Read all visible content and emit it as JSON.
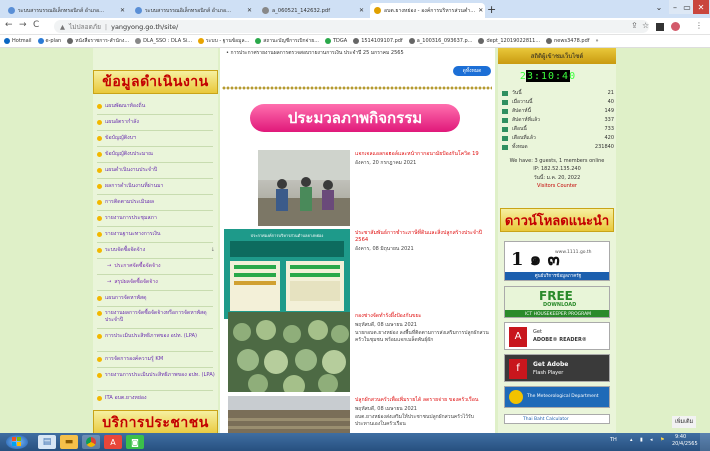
{
  "browser": {
    "tabs": [
      {
        "title": "ระบบสารบรรณอิเล็กทรอนิกส์ อำเภอ...",
        "active": false
      },
      {
        "title": "ระบบสารบรรณอิเล็กทรอนิกส์ อำเภอ...",
        "active": false
      },
      {
        "title": "a_060521_142632.pdf",
        "active": false
      },
      {
        "title": "อบต.ยางหย่อง - องค์การบริหารส่วนตำ...",
        "active": true
      }
    ],
    "new_tab": "+",
    "address": {
      "security": "ไม่ปลอดภัย",
      "url": "yangyong.go.th/site/"
    },
    "bookmarks": [
      "Hotmail",
      "e-plan",
      "หนังสือราชการ-สำนักง...",
      "DLA_SSO : DLA Si...",
      "ระบบ - ฐานข้อมูล...",
      "สถานะบัญชีการเบิกจ่าย...",
      "TDGA",
      "1514109107.pdf",
      "a_100316_093637.p...",
      "dept_12019022811...",
      "news3478.pdf"
    ],
    "bookmarks_more": "»"
  },
  "left": {
    "heading": "ข้อมูลดำเนินงาน",
    "items": [
      {
        "label": "แผนพัฒนาท้องถิ่น",
        "sub": false
      },
      {
        "label": "แผนอัตรากำลัง",
        "sub": false
      },
      {
        "label": "ข้อบัญญัติงบฯ",
        "sub": false
      },
      {
        "label": "ข้อบัญญัติงบประมาณ",
        "sub": false
      },
      {
        "label": "แผนดำเนินงานประจำปี",
        "sub": false
      },
      {
        "label": "ผลการดำเนินงานที่ผ่านมา",
        "sub": false
      },
      {
        "label": "การติดตามประเมินผล",
        "sub": false
      },
      {
        "label": "รายงานการประชุมสภา",
        "sub": false
      },
      {
        "label": "รายงานฐานะทางการเงิน",
        "sub": false
      },
      {
        "label": "ระบบจัดซื้อจัดจ้าง",
        "sub": false,
        "arrow": "↓"
      },
      {
        "label": "ประกาศจัดซื้อจัดจ้าง",
        "sub": true
      },
      {
        "label": "สรุปผลจัดซื้อจัดจ้าง",
        "sub": true
      },
      {
        "label": "แผนการจัดหาพัสดุ",
        "sub": false
      },
      {
        "label": "รายงานผลการจัดซื้อจัดจ้างหรือการจัดหาพัสดุประจำปี",
        "sub": false
      },
      {
        "label": "การประเมินประสิทธิภาพของ อปท. (LPA)",
        "sub": false
      },
      {
        "label": "การจัดการองค์ความรู้ KM",
        "sub": false
      },
      {
        "label": "รายงานการประเมินประสิทธิภาพของ อปท. (LPA)",
        "sub": false
      },
      {
        "label": "ITA อบต.ยางหย่อง",
        "sub": false
      }
    ],
    "heading2": "บริการประชาชน"
  },
  "center": {
    "marquee": "• การประกาศรายงานผลการตรวจสอบรายงานการเงิน ประจำปี 25 มกราคม 2565",
    "more_button": "ดูทั้งหมด",
    "banner": "ประมวลภาพกิจกรรม",
    "news": [
      {
        "title": "แจกเจลแอลกอฮอล์และหน้ากากอนามัยป้องกันโควิด 19",
        "date": "อังคาร, 20 กรกฎาคม 2021",
        "body": ""
      },
      {
        "title": "ประชาสัมพันธ์การชำระภาษีที่ดินและสิ่งปลูกสร้างประจำปี 2564",
        "date": "อังคาร, 08 มิถุนายน 2021",
        "body": ""
      },
      {
        "title": "กองช่างจัดทำรังผึ้งป้องกันขยะ",
        "date": "พฤหัสบดี, 08 เมษายน 2021",
        "body": "นายกอบต.ยางหย่อง ลงพื้นที่ติดตามการส่งเสริมการปลูกผักสวนครัวในชุมชน พร้อมแจกเมล็ดพันธุ์ผัก"
      },
      {
        "title": "ปลูกผักสวนครัวเพื่อเพิ่มรายได้ ลดรายจ่าย ของครัวเรือน",
        "date": "พฤหัสบดี, 08 เมษายน 2021",
        "body": "อบต.ยางหย่องส่งเสริมให้ประชาชนปลูกผักสวนครัวไว้รับประทานเองในครัวเรือน"
      }
    ],
    "poster_text": "ประกาศองค์การบริหารส่วนตำบลยางหย่อง"
  },
  "right": {
    "top_label": "สถิติผู้เข้าชมเว็บไซต์",
    "clock": "23:10:40",
    "stats": [
      {
        "label": "วันนี้",
        "value": "21"
      },
      {
        "label": "เมื่อวานนี้",
        "value": "40"
      },
      {
        "label": "สัปดาห์นี้",
        "value": "149"
      },
      {
        "label": "สัปดาห์ที่แล้ว",
        "value": "337"
      },
      {
        "label": "เดือนนี้",
        "value": "733"
      },
      {
        "label": "เดือนที่แล้ว",
        "value": "420"
      },
      {
        "label": "ทั้งหมด",
        "value": "231840"
      }
    ],
    "online": "We have: 3 guests, 1 members online",
    "ip": "IP: 182.52.135.240",
    "date": "วันนี้: ม.ค. 20, 2022",
    "counter": "Visitors Counter",
    "heading2": "ดาวน์โหลดแนะนำ",
    "downloads": [
      {
        "big": "1 ๑ ๓",
        "sub": "www.1111.go.th",
        "caption": "ศูนย์บริการข้อมูลภาครัฐ"
      },
      {
        "big": "FREE",
        "sub": "DOWNLOAD",
        "caption": "ICT HOUSEKEEPER PROGRAM"
      },
      {
        "big": "Get",
        "sub": "ADOBE® READER®",
        "caption": ""
      },
      {
        "big": "Get Adobe",
        "sub": "Flash Player",
        "caption": ""
      },
      {
        "big": "The Meteorological Department",
        "sub": "",
        "caption": ""
      }
    ],
    "last": "Thai Baht Calculator"
  },
  "feedback": "เพิ่มเติม",
  "taskbar": {
    "lang": "TH",
    "time": "9:40",
    "date": "20/4/2565"
  }
}
